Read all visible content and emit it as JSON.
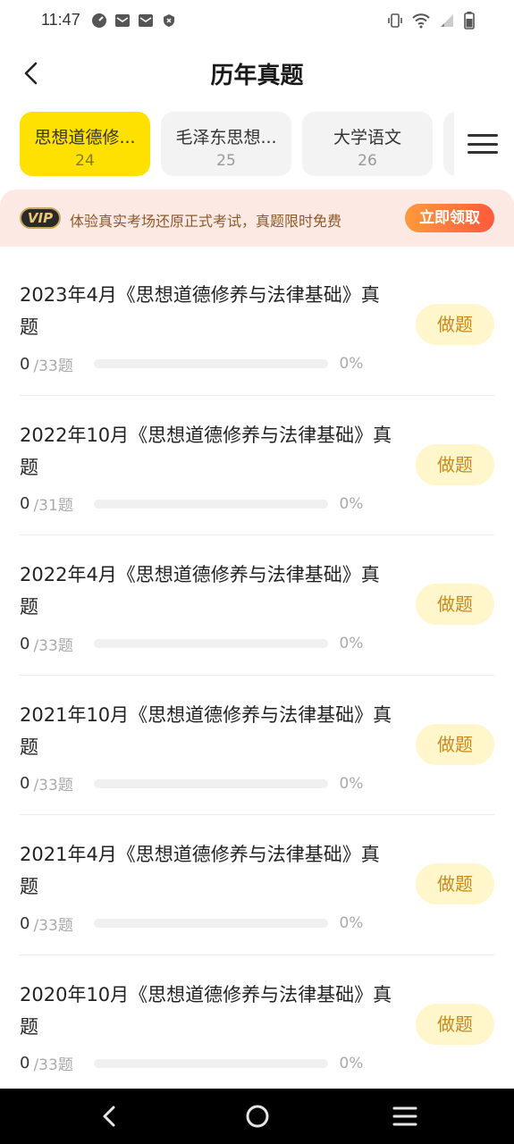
{
  "status_bar": {
    "time": "11:47",
    "left_icons": [
      "speedometer-icon",
      "mail-icon",
      "mail-icon",
      "shield-icon"
    ],
    "right_icons": [
      "vibrate-icon",
      "wifi-icon",
      "signal-icon",
      "battery-icon"
    ]
  },
  "header": {
    "title": "历年真题"
  },
  "tabs": [
    {
      "title": "思想道德修...",
      "count": "24",
      "active": true
    },
    {
      "title": "毛泽东思想...",
      "count": "25",
      "active": false
    },
    {
      "title": "大学语文",
      "count": "26",
      "active": false
    }
  ],
  "vip_banner": {
    "badge": "VIP",
    "text": "体验真实考场还原正式考试，真题限时免费",
    "button": "立即领取"
  },
  "exams": [
    {
      "title": "2023年4月《思想道德修养与法律基础》真题",
      "done": "0",
      "total": "/33题",
      "percent": "0%",
      "progress": 0,
      "button": "做题"
    },
    {
      "title": "2022年10月《思想道德修养与法律基础》真题",
      "done": "0",
      "total": "/31题",
      "percent": "0%",
      "progress": 0,
      "button": "做题"
    },
    {
      "title": "2022年4月《思想道德修养与法律基础》真题",
      "done": "0",
      "total": "/33题",
      "percent": "0%",
      "progress": 0,
      "button": "做题"
    },
    {
      "title": "2021年10月《思想道德修养与法律基础》真题",
      "done": "0",
      "total": "/33题",
      "percent": "0%",
      "progress": 0,
      "button": "做题"
    },
    {
      "title": "2021年4月《思想道德修养与法律基础》真题",
      "done": "0",
      "total": "/33题",
      "percent": "0%",
      "progress": 0,
      "button": "做题"
    },
    {
      "title": "2020年10月《思想道德修养与法律基础》真题",
      "done": "0",
      "total": "/33题",
      "percent": "0%",
      "progress": 0,
      "button": "做题"
    }
  ],
  "colors": {
    "accent": "#ffe100",
    "button_bg": "#fff6cc",
    "button_text": "#c78a1a",
    "banner_bg": "#fde9e4"
  }
}
